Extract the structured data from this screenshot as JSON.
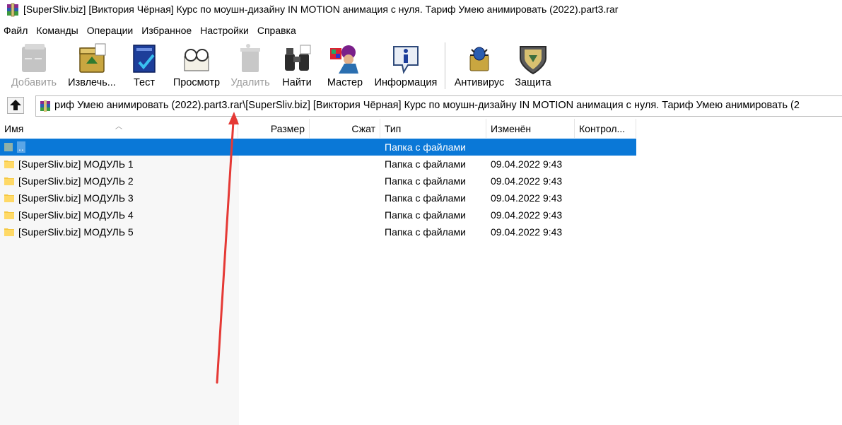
{
  "window": {
    "title": "[SuperSliv.biz] [Виктория Чёрная] Курс по моушн-дизайну IN MOTION анимация с нуля. Тариф Умею анимировать (2022).part3.rar"
  },
  "menu": [
    "Файл",
    "Команды",
    "Операции",
    "Избранное",
    "Настройки",
    "Справка"
  ],
  "toolbar": {
    "add": "Добавить",
    "extract": "Извлечь...",
    "test": "Тест",
    "view": "Просмотр",
    "delete": "Удалить",
    "find": "Найти",
    "wizard": "Мастер",
    "info": "Информация",
    "antivirus": "Антивирус",
    "protect": "Защита"
  },
  "address": {
    "path": "риф Умею анимировать (2022).part3.rar\\[SuperSliv.biz] [Виктория Чёрная] Курс по моушн-дизайну IN MOTION анимация с нуля. Тариф Умею анимировать (2"
  },
  "columns": {
    "name": "Имя",
    "size": "Размер",
    "packed": "Сжат",
    "type": "Тип",
    "modified": "Изменён",
    "crc": "Контрол..."
  },
  "rows": [
    {
      "name": "..",
      "type": "Папка с файлами",
      "modified": ""
    },
    {
      "name": "[SuperSliv.biz] МОДУЛЬ 1",
      "type": "Папка с файлами",
      "modified": "09.04.2022 9:43"
    },
    {
      "name": "[SuperSliv.biz] МОДУЛЬ 2",
      "type": "Папка с файлами",
      "modified": "09.04.2022 9:43"
    },
    {
      "name": "[SuperSliv.biz] МОДУЛЬ 3",
      "type": "Папка с файлами",
      "modified": "09.04.2022 9:43"
    },
    {
      "name": "[SuperSliv.biz] МОДУЛЬ 4",
      "type": "Папка с файлами",
      "modified": "09.04.2022 9:43"
    },
    {
      "name": "[SuperSliv.biz] МОДУЛЬ 5",
      "type": "Папка с файлами",
      "modified": "09.04.2022 9:43"
    }
  ],
  "colors": {
    "selection": "#0a78d7",
    "annotation_arrow": "#e53935"
  }
}
